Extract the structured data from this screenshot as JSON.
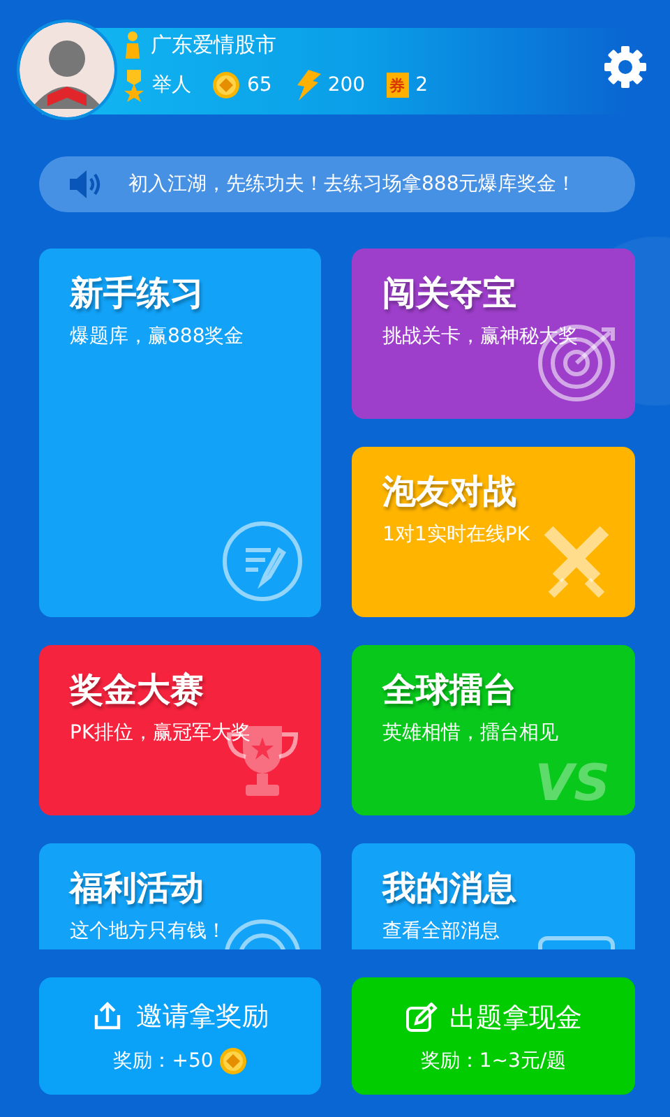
{
  "profile": {
    "name": "广东爱情股市",
    "rank": "举人",
    "coins": "65",
    "energy": "200",
    "ticket_icon": "券",
    "tickets": "2"
  },
  "notice": "初入江湖，先练功夫！去练习场拿888元爆库奖金！",
  "tiles": [
    {
      "title": "新手练习",
      "subtitle": "爆题库，赢888奖金",
      "color": "#12a2f8"
    },
    {
      "title": "闯关夺宝",
      "subtitle": "挑战关卡，赢神秘大奖",
      "color": "#9d3fca"
    },
    {
      "title": "泡友对战",
      "subtitle": "1对1实时在线PK",
      "color": "#ffb400"
    },
    {
      "title": "奖金大赛",
      "subtitle": "PK排位，赢冠军大奖",
      "color": "#f5233e"
    },
    {
      "title": "全球擂台",
      "subtitle": "英雄相惜，擂台相见",
      "color": "#08c81c",
      "emblem": "VS"
    },
    {
      "title": "福利活动",
      "subtitle": "这个地方只有钱！",
      "color": "#12a2f8"
    },
    {
      "title": "我的消息",
      "subtitle": "查看全部消息",
      "color": "#12a2f8"
    }
  ],
  "actions": [
    {
      "label": "邀请拿奖励",
      "reward": "奖励：+50",
      "color": "#0aa2f8"
    },
    {
      "label": "出题拿现金",
      "reward": "奖励：1~3元/题",
      "color": "#00cc00"
    }
  ]
}
